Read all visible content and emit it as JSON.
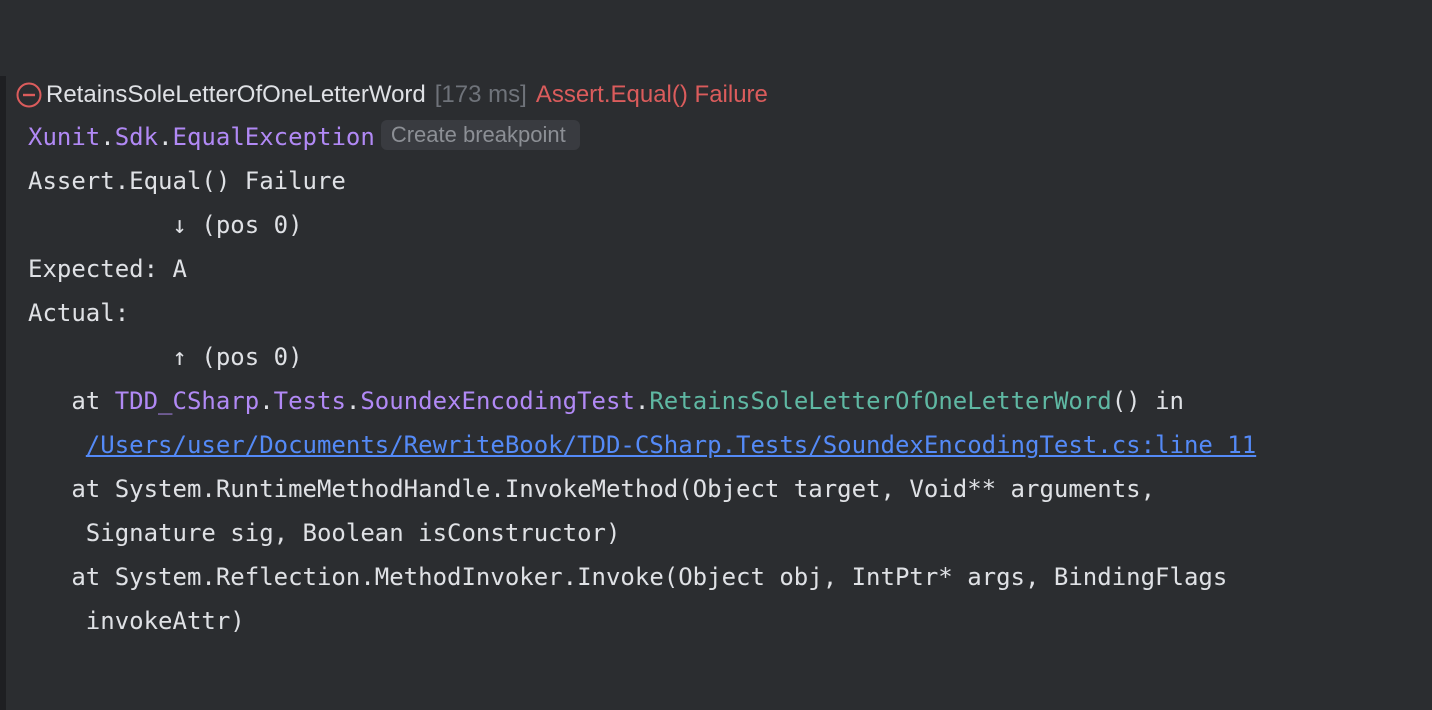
{
  "header": {
    "test_name": "RetainsSoleLetterOfOneLetterWord",
    "duration": "[173 ms]",
    "message": "Assert.Equal() Failure"
  },
  "exception": {
    "ns1": "Xunit",
    "dot1": ".",
    "ns2": "Sdk",
    "dot2": ".",
    "cls": "EqualException",
    "breakpoint_label": "Create breakpoint"
  },
  "output": {
    "line_failure": "Assert.Equal() Failure",
    "line_pos_down": "          ↓ (pos 0)",
    "line_expected": "Expected: A",
    "line_actual": "Actual:",
    "line_pos_up": "          ↑ (pos 0)"
  },
  "stack": {
    "frame1": {
      "at": "   at ",
      "ns1": "TDD_CSharp",
      "dot1": ".",
      "ns2": "Tests",
      "dot2": ".",
      "cls": "SoundexEncodingTest",
      "dot3": ".",
      "method": "RetainsSoleLetterOfOneLetterWord",
      "tail": "() in",
      "indent": "    ",
      "path": "/Users/user/Documents/RewriteBook/TDD-CSharp.Tests/SoundexEncodingTest.cs:line 11"
    },
    "frame2_line1": "   at System.RuntimeMethodHandle.InvokeMethod(Object target, Void** arguments,",
    "frame2_line2": "    Signature sig, Boolean isConstructor)",
    "frame3_line1": "   at System.Reflection.MethodInvoker.Invoke(Object obj, IntPtr* args, BindingFlags",
    "frame3_line2": "    invokeAttr)"
  },
  "colors": {
    "background": "#2b2d30",
    "error": "#db5c5c",
    "type_purple": "#b189f5",
    "method_green": "#5fb8a3",
    "link_blue": "#548af7"
  }
}
